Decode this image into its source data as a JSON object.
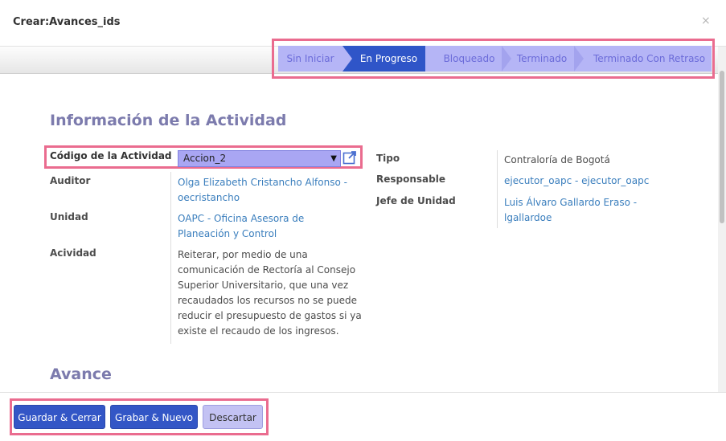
{
  "dialog": {
    "title": "Crear:Avances_ids",
    "close_glyph": "×"
  },
  "statusbar": {
    "stages": [
      {
        "label": "Sin Iniciar",
        "active": false
      },
      {
        "label": "En Progreso",
        "active": true
      },
      {
        "label": "Bloqueado",
        "active": false
      },
      {
        "label": "Terminado",
        "active": false
      },
      {
        "label": "Terminado Con Retraso",
        "active": false
      }
    ]
  },
  "sections": {
    "info_title": "Información de la Actividad",
    "avance_title": "Avance"
  },
  "fields": {
    "codigo": {
      "label": "Código de la Actividad",
      "value": "Accion_2"
    },
    "auditor": {
      "label": "Auditor",
      "line1": "Olga Elizabeth Cristancho Alfonso -",
      "line2": "oecristancho"
    },
    "unidad": {
      "label": "Unidad",
      "line1": "OAPC - Oficina Asesora de",
      "line2": "Planeación y Control"
    },
    "acividad": {
      "label": "Acividad",
      "lines": [
        "Reiterar, por medio de una",
        "comunicación de Rectoría al Consejo",
        "Superior Universitario, que una vez",
        "recaudados los recursos no se puede",
        "reducir el presupuesto de gastos si ya",
        "existe el recaudo de los ingresos."
      ]
    },
    "tipo": {
      "label": "Tipo",
      "value": "Contraloría de Bogotá"
    },
    "responsable": {
      "label": "Responsable",
      "value": "ejecutor_oapc - ejecutor_oapc"
    },
    "jefe": {
      "label": "Jefe de Unidad",
      "line1": "Luis Álvaro Gallardo Eraso -",
      "line2": "lgallardoe"
    }
  },
  "footer": {
    "save_close": "Guardar & Cerrar",
    "save_new": "Grabar & Nuevo",
    "discard": "Descartar"
  },
  "colors": {
    "accent": "#2f55c8",
    "highlight": "#ea6c8f",
    "link": "#3a7ebd",
    "section_title": "#7c7bad"
  }
}
